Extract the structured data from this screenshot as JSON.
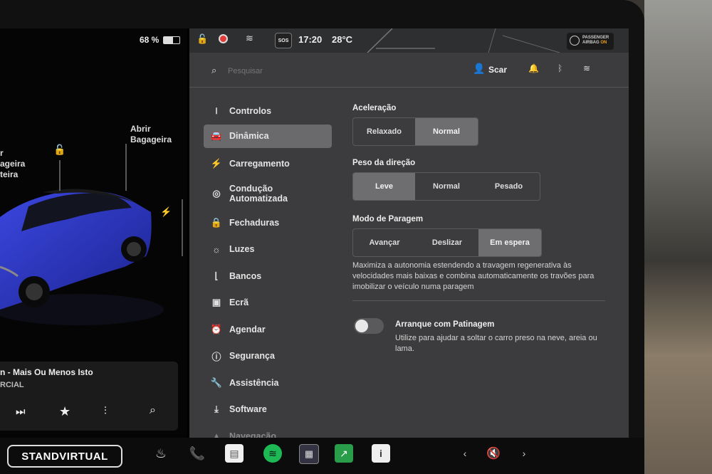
{
  "status": {
    "battery": "68 %",
    "time": "17:20",
    "temperature": "28°C",
    "sos": "SOS",
    "airbag_line1": "PASSENGER",
    "airbag_line2": "AIRBAG",
    "airbag_state": "ON"
  },
  "search": {
    "placeholder": "Pesquisar"
  },
  "profile": {
    "name": "Scar"
  },
  "car_labels": {
    "open_trunk_line1": "Abrir",
    "open_trunk_line2": "Bagageira",
    "frunk_line1": "r",
    "frunk_line2": "ageira",
    "frunk_line3": "teira"
  },
  "media": {
    "title": "n - Mais Ou Menos Isto",
    "subtitle": "RCIAL"
  },
  "menu": [
    {
      "label": "Controlos",
      "icon": "toggle-icon",
      "glyph": "⏽"
    },
    {
      "label": "Dinâmica",
      "icon": "car-icon",
      "glyph": "🚘"
    },
    {
      "label": "Carregamento",
      "icon": "bolt-icon",
      "glyph": "⚡"
    },
    {
      "label": "Condução Automatizada",
      "icon": "steering-wheel-icon",
      "glyph": "◎"
    },
    {
      "label": "Fechaduras",
      "icon": "lock-icon",
      "glyph": "🔒"
    },
    {
      "label": "Luzes",
      "icon": "light-icon",
      "glyph": "☼"
    },
    {
      "label": "Bancos",
      "icon": "seat-icon",
      "glyph": "⌊"
    },
    {
      "label": "Ecrã",
      "icon": "screen-icon",
      "glyph": "▣"
    },
    {
      "label": "Agendar",
      "icon": "clock-icon",
      "glyph": "⏰"
    },
    {
      "label": "Segurança",
      "icon": "alert-icon",
      "glyph": "ⓘ"
    },
    {
      "label": "Assistência",
      "icon": "wrench-icon",
      "glyph": "🔧"
    },
    {
      "label": "Software",
      "icon": "download-icon",
      "glyph": "⤓"
    },
    {
      "label": "Navegação",
      "icon": "navigation-icon",
      "glyph": "▲"
    }
  ],
  "settings": {
    "acceleration": {
      "label": "Aceleração",
      "options": [
        "Relaxado",
        "Normal"
      ],
      "selected": "Normal"
    },
    "steering": {
      "label": "Peso da direção",
      "options": [
        "Leve",
        "Normal",
        "Pesado"
      ],
      "selected": "Leve"
    },
    "stopping": {
      "label": "Modo de Paragem",
      "options": [
        "Avançar",
        "Deslizar",
        "Em espera"
      ],
      "selected": "Em espera",
      "description": "Maximiza a autonomia estendendo a travagem regenerativa às velocidades mais baixas e combina automaticamente os travões para imobilizar o veículo numa paragem"
    },
    "slip_start": {
      "label": "Arranque com Patinagem",
      "enabled": false,
      "description": "Utilize para ajudar a soltar o carro preso na neve, areia ou lama."
    }
  },
  "watermark": "STANDVIRTUAL",
  "colors": {
    "panel": "#3c3c3e",
    "selected": "#6e6e70",
    "car": "#2a35c8"
  }
}
